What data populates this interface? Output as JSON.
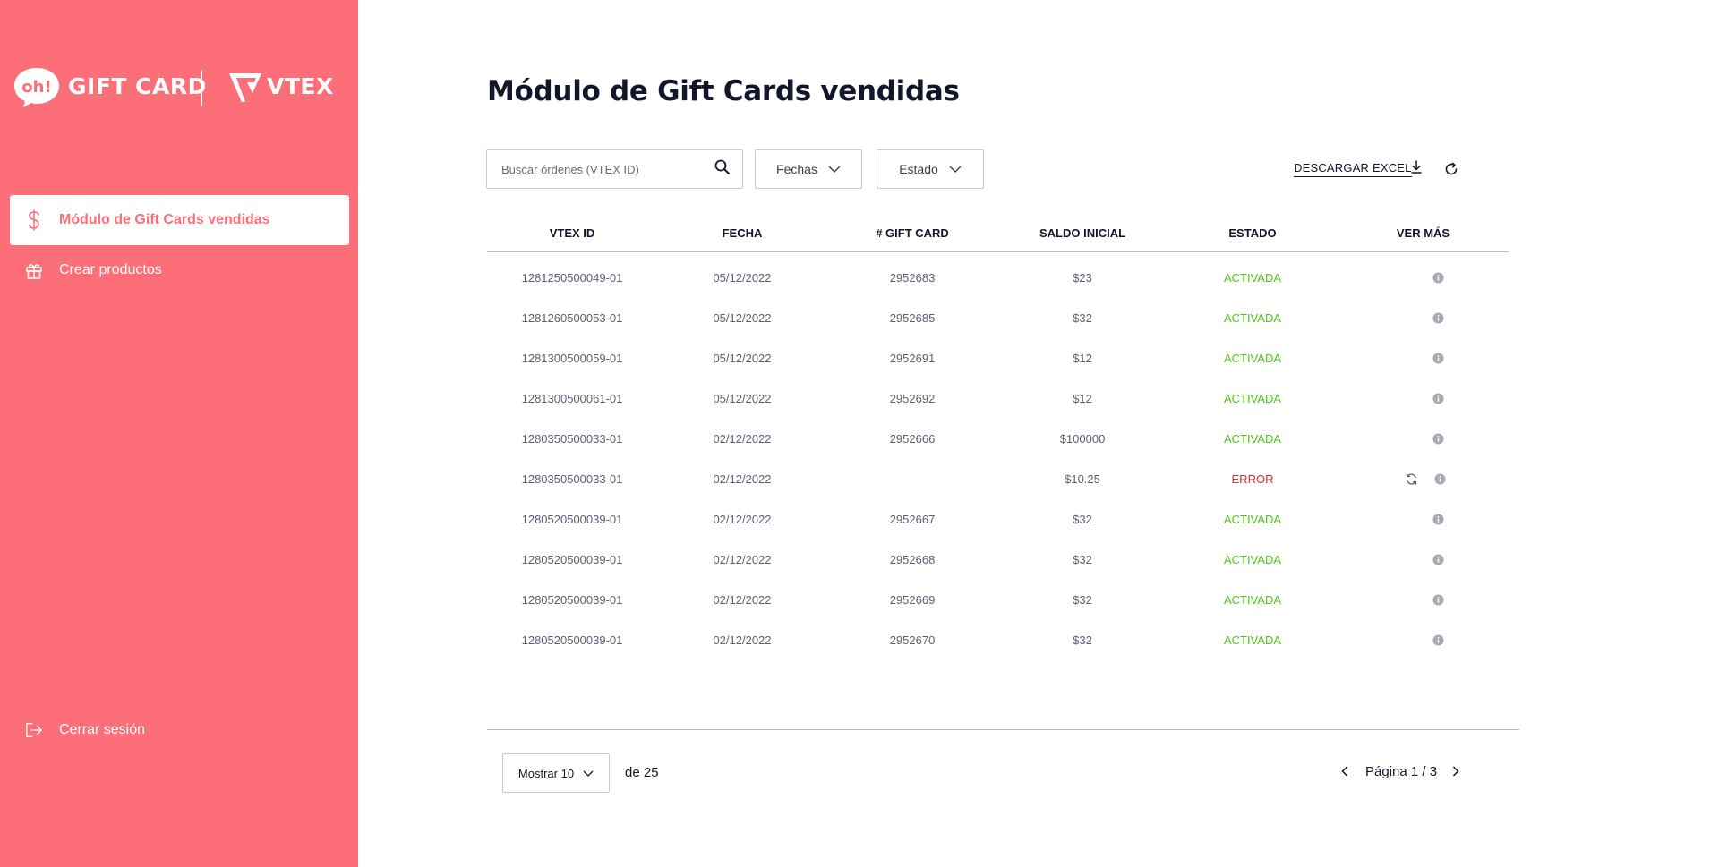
{
  "brand": {
    "oh_text": "oh!",
    "gift_text": "GIFT CARD",
    "vtex_text": "VTEX",
    "accent": "#fc6f78"
  },
  "sidebar": {
    "items": [
      {
        "label": "Módulo de Gift Cards vendidas",
        "icon": "dollar-icon",
        "active": true
      },
      {
        "label": "Crear productos",
        "icon": "gift-icon",
        "active": false
      }
    ],
    "logout_label": "Cerrar sesión"
  },
  "main": {
    "title": "Módulo de Gift Cards vendidas",
    "search_placeholder": "Buscar órdenes (VTEX ID)",
    "filter_dates": "Fechas",
    "filter_status": "Estado",
    "download_label": "DESCARGAR EXCEL"
  },
  "table": {
    "headers": [
      "VTEX ID",
      "FECHA",
      "# GIFT CARD",
      "SALDO INICIAL",
      "ESTADO",
      "VER MÁS"
    ],
    "rows": [
      {
        "vtex_id": "1281250500049-01",
        "fecha": "05/12/2022",
        "gift_card": "2952683",
        "saldo": "$23",
        "estado": "ACTIVADA"
      },
      {
        "vtex_id": "1281260500053-01",
        "fecha": "05/12/2022",
        "gift_card": "2952685",
        "saldo": "$32",
        "estado": "ACTIVADA"
      },
      {
        "vtex_id": "1281300500059-01",
        "fecha": "05/12/2022",
        "gift_card": "2952691",
        "saldo": "$12",
        "estado": "ACTIVADA"
      },
      {
        "vtex_id": "1281300500061-01",
        "fecha": "05/12/2022",
        "gift_card": "2952692",
        "saldo": "$12",
        "estado": "ACTIVADA"
      },
      {
        "vtex_id": "1280350500033-01",
        "fecha": "02/12/2022",
        "gift_card": "2952666",
        "saldo": "$100000",
        "estado": "ACTIVADA"
      },
      {
        "vtex_id": "1280350500033-01",
        "fecha": "02/12/2022",
        "gift_card": "",
        "saldo": "$10.25",
        "estado": "ERROR"
      },
      {
        "vtex_id": "1280520500039-01",
        "fecha": "02/12/2022",
        "gift_card": "2952667",
        "saldo": "$32",
        "estado": "ACTIVADA"
      },
      {
        "vtex_id": "1280520500039-01",
        "fecha": "02/12/2022",
        "gift_card": "2952668",
        "saldo": "$32",
        "estado": "ACTIVADA"
      },
      {
        "vtex_id": "1280520500039-01",
        "fecha": "02/12/2022",
        "gift_card": "2952669",
        "saldo": "$32",
        "estado": "ACTIVADA"
      },
      {
        "vtex_id": "1280520500039-01",
        "fecha": "02/12/2022",
        "gift_card": "2952670",
        "saldo": "$32",
        "estado": "ACTIVADA"
      }
    ],
    "status_colors": {
      "ACTIVADA": "#52c41a",
      "ERROR": "#e0282d"
    }
  },
  "footer": {
    "show_label": "Mostrar 10",
    "total_label": "de 25",
    "page_label": "Página 1 / 3"
  }
}
